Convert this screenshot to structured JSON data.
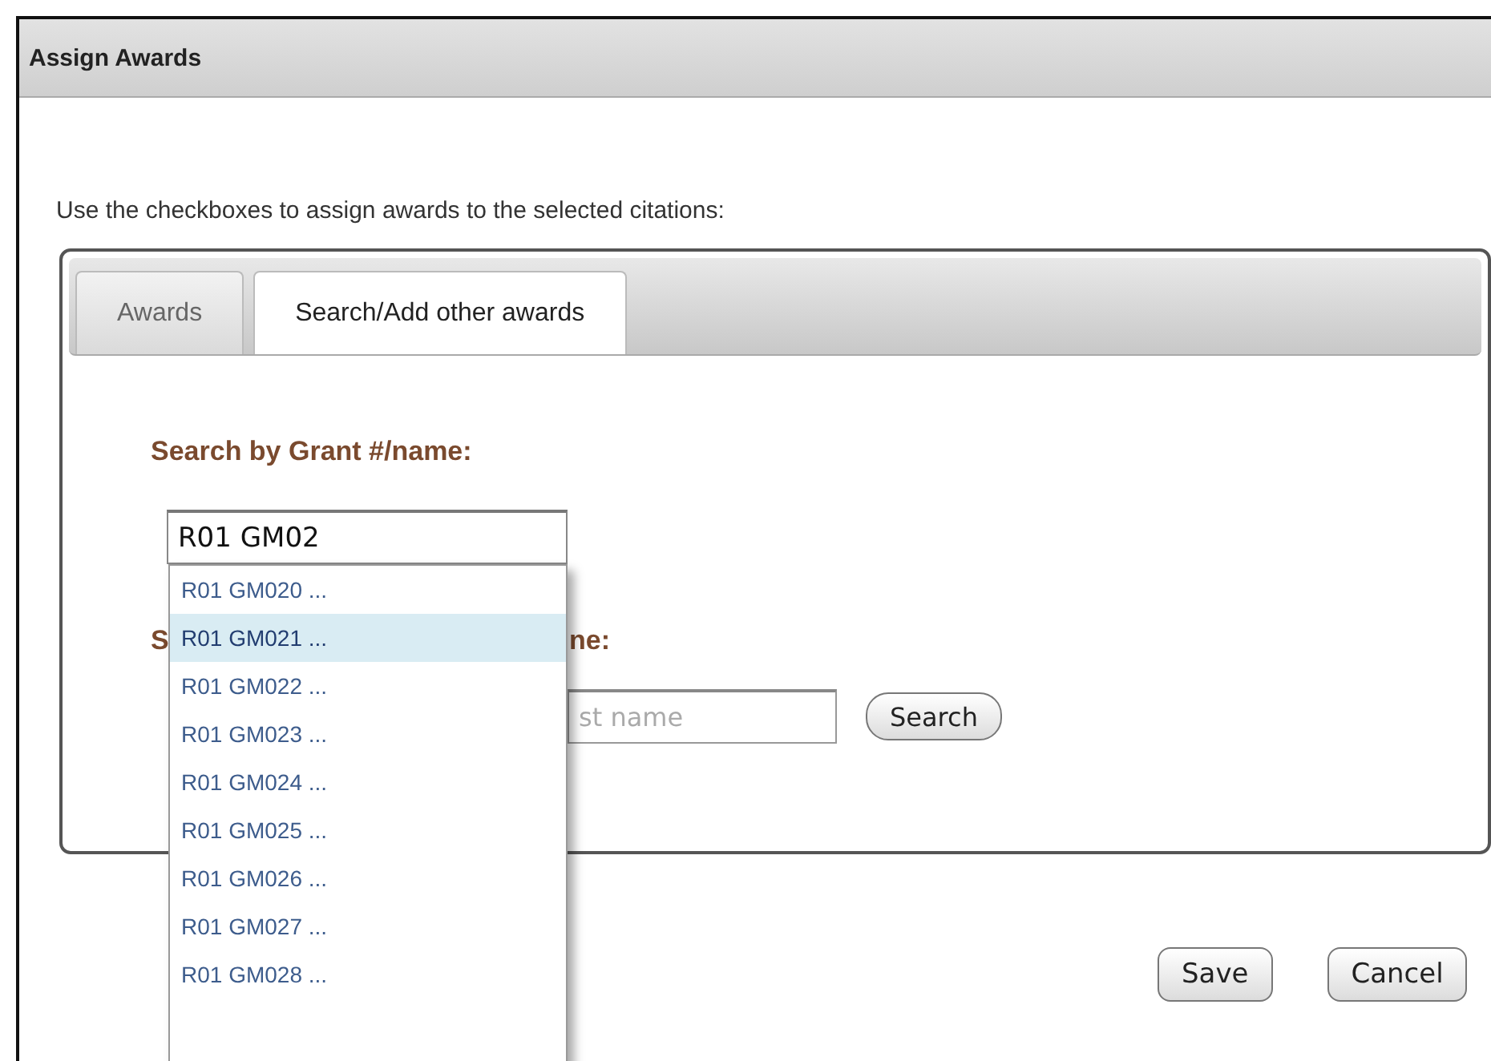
{
  "dialog": {
    "title": "Assign Awards"
  },
  "instruction": "Use the checkboxes to assign awards to the selected citations:",
  "tabs": [
    {
      "label": "Awards",
      "selected": false
    },
    {
      "label": "Search/Add other awards",
      "selected": true
    }
  ],
  "grant_search": {
    "label": "Search by Grant #/name:",
    "value": "R01 GM02",
    "suggestions": [
      {
        "label": "R01 GM020 ...",
        "selected": false
      },
      {
        "label": "R01 GM021 ...",
        "selected": true
      },
      {
        "label": "R01 GM022 ...",
        "selected": false
      },
      {
        "label": "R01 GM023 ...",
        "selected": false
      },
      {
        "label": "R01 GM024 ...",
        "selected": false
      },
      {
        "label": "R01 GM025 ...",
        "selected": false
      },
      {
        "label": "R01 GM026 ...",
        "selected": false
      },
      {
        "label": "R01 GM027 ...",
        "selected": false
      },
      {
        "label": "R01 GM028 ...",
        "selected": false
      }
    ]
  },
  "name_search": {
    "label_start": "S",
    "label_end": "ne:",
    "placeholder": "st name",
    "button": "Search"
  },
  "buttons": [
    "Save",
    "Cancel"
  ]
}
